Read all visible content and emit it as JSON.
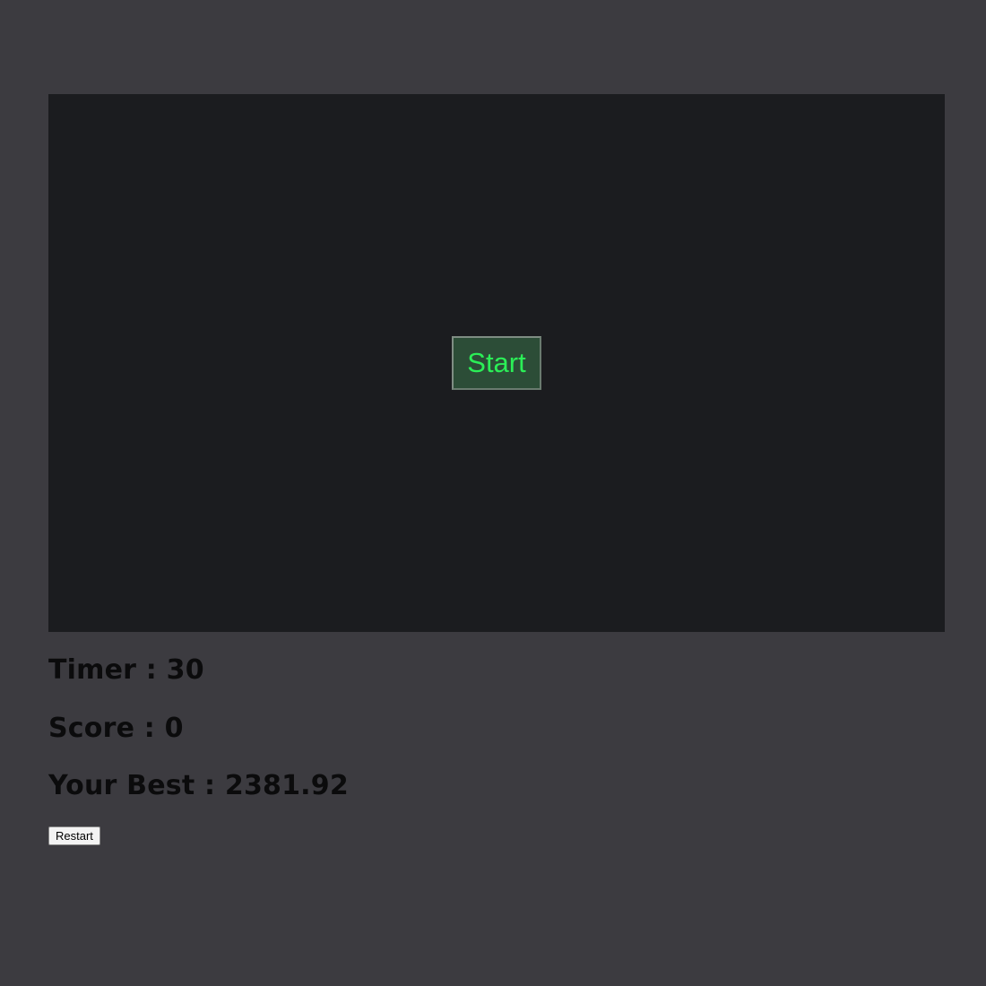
{
  "game": {
    "start_label": "Start"
  },
  "stats": {
    "timer_label": "Timer : ",
    "timer_value": "30",
    "score_label": "Score : ",
    "score_value": "0",
    "best_label": "Your Best : ",
    "best_value": "2381.92"
  },
  "controls": {
    "restart_label": "Restart"
  },
  "colors": {
    "page_background": "#3c3b40",
    "game_background": "#1b1c1f",
    "start_text": "#2bef57",
    "start_background": "#2c4d37"
  }
}
